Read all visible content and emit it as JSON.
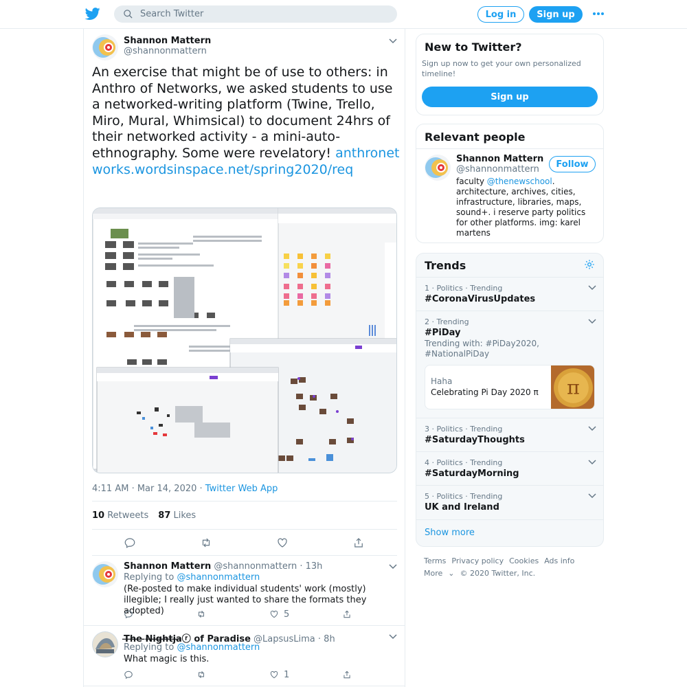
{
  "search": {
    "placeholder": "Search Twitter"
  },
  "header": {
    "login_label": "Log in",
    "signup_label": "Sign up"
  },
  "tweet": {
    "author_name": "Shannon Mattern",
    "author_handle": "@shannonmattern",
    "text": "An exercise that might be of use to others: in Anthro of Networks, we asked students to use a networked-writing platform (Twine, Trello, Miro, Mural, Whimsical) to document 24hrs of their networked activity - a mini-auto-ethnography. Some were revelatory!",
    "link": "anthronetworks.wordsinspace.net/spring2020/req",
    "timestamp": "4:11 AM · Mar 14, 2020 · ",
    "source": "Twitter Web App",
    "retweets_count": "10",
    "retweets_label": "Retweets",
    "likes_count": "87",
    "likes_label": "Likes"
  },
  "replies": [
    {
      "author_name": "Shannon Mattern",
      "author_handle": "@shannonmattern · 13h",
      "replying_to_label": "Replying to ",
      "replying_to": "@shannonmattern",
      "text": "(Re-posted to make individual students' work (mostly) illegible; I really just wanted to share the formats they adopted)",
      "likes": "5"
    },
    {
      "author_name": "T̶h̶e̶ ̶N̶i̶g̶h̶t̶j̶a̶ⓡ of Paradise",
      "author_handle": "@LapsusLima · 8h",
      "replying_to_label": "Replying to ",
      "replying_to": "@shannonmattern",
      "text": "What magic is this.",
      "likes": "1"
    }
  ],
  "sidebar": {
    "new_card": {
      "title": "New to Twitter?",
      "subtitle": "Sign up now to get your own personalized timeline!",
      "button_label": "Sign up"
    },
    "relevant": {
      "title": "Relevant people",
      "name": "Shannon Mattern",
      "handle": "@shannonmattern",
      "follow_label": "Follow",
      "bio_prefix": "faculty ",
      "bio_link": "@thenewschool",
      "bio_rest": ". architecture, archives, cities, infrastructure, libraries, maps, sound+. i reserve party politics for other platforms. img: karel martens"
    },
    "trends": {
      "title": "Trends",
      "items": [
        {
          "context": "1 · Politics · Trending",
          "name": "#CoronaVirusUpdates"
        },
        {
          "context": "2 · Trending",
          "name": "#PiDay",
          "with": "Trending with: #PiDay2020, #NationalPiDay",
          "moment_label": "Haha",
          "moment_title": "Celebrating Pi Day 2020 π"
        },
        {
          "context": "3 · Politics · Trending",
          "name": "#SaturdayThoughts"
        },
        {
          "context": "4 · Politics · Trending",
          "name": "#SaturdayMorning"
        },
        {
          "context": "5 · Politics · Trending",
          "name": "UK and Ireland"
        }
      ],
      "show_more": "Show more"
    },
    "footer": {
      "links": [
        "Terms",
        "Privacy policy",
        "Cookies",
        "Ads info"
      ],
      "more": "More",
      "copyright": "© 2020 Twitter, Inc."
    }
  },
  "colors": {
    "brand": "#1da1f2",
    "link": "#1b95e0"
  },
  "icons": [
    "twitter-bird-icon",
    "search-icon",
    "more-icon",
    "chevron-down-icon",
    "reply-icon",
    "retweet-icon",
    "like-icon",
    "share-icon",
    "settings-icon"
  ]
}
